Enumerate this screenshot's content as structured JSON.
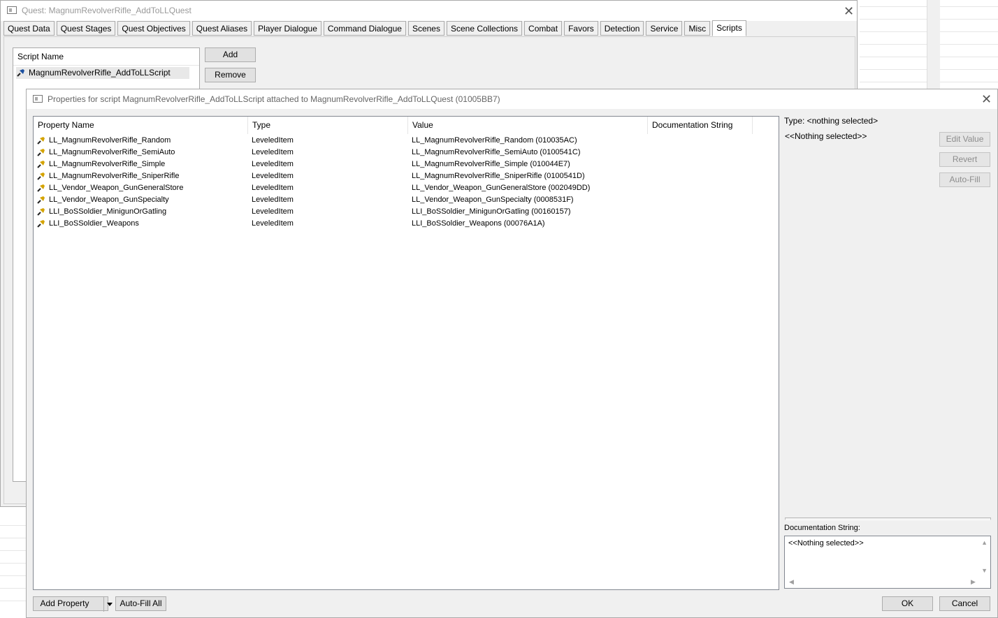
{
  "quest_window": {
    "title": "Quest: MagnumRevolverRifle_AddToLLQuest",
    "tabs": [
      "Quest Data",
      "Quest Stages",
      "Quest Objectives",
      "Quest Aliases",
      "Player Dialogue",
      "Command Dialogue",
      "Scenes",
      "Scene Collections",
      "Combat",
      "Favors",
      "Detection",
      "Service",
      "Misc",
      "Scripts"
    ],
    "active_tab": "Scripts",
    "script_list_header": "Script Name",
    "scripts": [
      "MagnumRevolverRifle_AddToLLScript"
    ],
    "add_label": "Add",
    "remove_label": "Remove"
  },
  "properties_dialog": {
    "title": "Properties for script MagnumRevolverRifle_AddToLLScript attached to MagnumRevolverRifle_AddToLLQuest (01005BB7)",
    "columns": {
      "property_name": "Property Name",
      "type": "Type",
      "value": "Value",
      "documentation": "Documentation String"
    },
    "rows": [
      {
        "name": "LL_MagnumRevolverRifle_Random",
        "type": "LeveledItem",
        "value": "LL_MagnumRevolverRifle_Random (010035AC)"
      },
      {
        "name": "LL_MagnumRevolverRifle_SemiAuto",
        "type": "LeveledItem",
        "value": "LL_MagnumRevolverRifle_SemiAuto (0100541C)"
      },
      {
        "name": "LL_MagnumRevolverRifle_Simple",
        "type": "LeveledItem",
        "value": "LL_MagnumRevolverRifle_Simple (010044E7)"
      },
      {
        "name": "LL_MagnumRevolverRifle_SniperRifle",
        "type": "LeveledItem",
        "value": "LL_MagnumRevolverRifle_SniperRifle (0100541D)"
      },
      {
        "name": "LL_Vendor_Weapon_GunGeneralStore",
        "type": "LeveledItem",
        "value": "LL_Vendor_Weapon_GunGeneralStore (002049DD)"
      },
      {
        "name": "LL_Vendor_Weapon_GunSpecialty",
        "type": "LeveledItem",
        "value": "LL_Vendor_Weapon_GunSpecialty (0008531F)"
      },
      {
        "name": "LLI_BoSSoldier_MinigunOrGatling",
        "type": "LeveledItem",
        "value": "LLI_BoSSoldier_MinigunOrGatling (00160157)"
      },
      {
        "name": "LLI_BoSSoldier_Weapons",
        "type": "LeveledItem",
        "value": "LLI_BoSSoldier_Weapons (00076A1A)"
      }
    ],
    "side_panel": {
      "type_label": "Type: <nothing selected>",
      "nothing_selected": "<<Nothing selected>>",
      "edit_value_label": "Edit Value",
      "revert_label": "Revert",
      "auto_fill_label": "Auto-Fill",
      "doc_string_label": "Documentation String:",
      "doc_string_value": "<<Nothing selected>>"
    },
    "add_property_label": "Add Property",
    "auto_fill_all_label": "Auto-Fill All",
    "ok_label": "OK",
    "cancel_label": "Cancel"
  }
}
